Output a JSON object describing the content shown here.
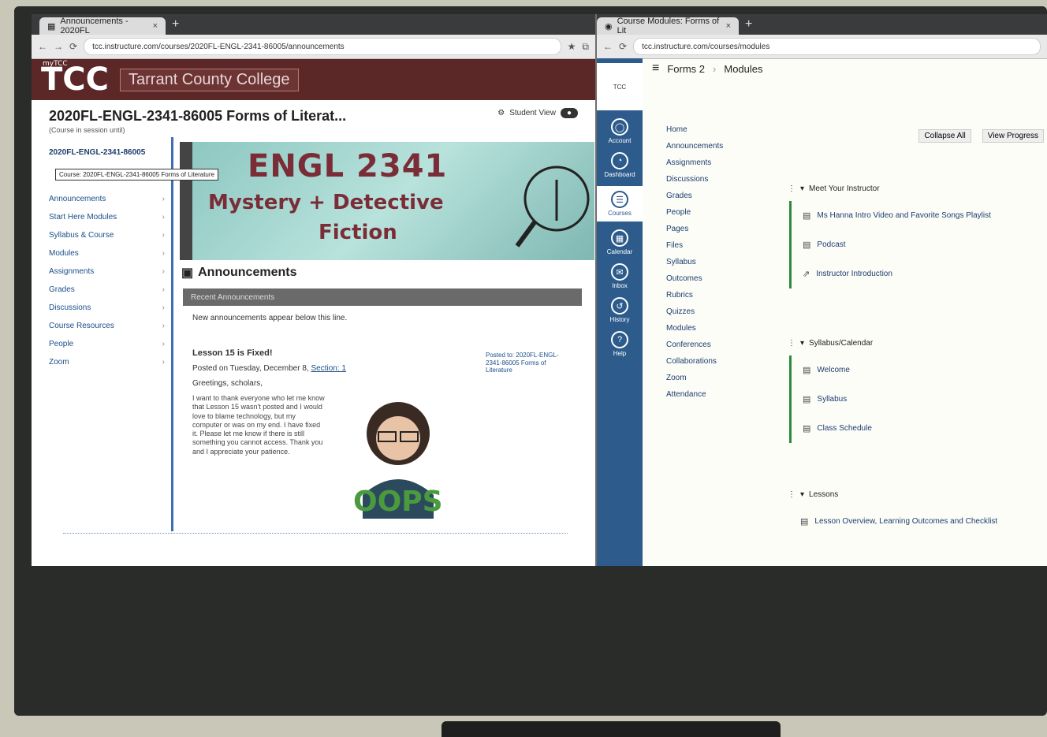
{
  "left_window": {
    "tab_title": "Announcements - 2020FL",
    "url": "tcc.instructure.com/courses/2020FL-ENGL-2341-86005/announcements",
    "tcc_logo": "TCC",
    "tcc_logo_small": "myTCC",
    "tcc_name": "Tarrant County College",
    "course_title": "2020FL-ENGL-2341-86005 Forms of Literat...",
    "course_sub": "(Course in session until)",
    "student_view": "Student View",
    "nav_crumb": "2020FL-ENGL-2341-86005",
    "tooltip": "Course: 2020FL-ENGL-2341-86005 Forms of Literature",
    "nav_items": [
      {
        "label": "Announcements"
      },
      {
        "label": "Start Here Modules"
      },
      {
        "label": "Syllabus & Course"
      },
      {
        "label": "Modules"
      },
      {
        "label": "Assignments"
      },
      {
        "label": "Grades"
      },
      {
        "label": "Discussions"
      },
      {
        "label": "Course Resources"
      },
      {
        "label": "People"
      },
      {
        "label": "Zoom"
      }
    ],
    "banner": {
      "line1": "ENGL 2341",
      "line2": "Mystery + Detective",
      "line3": "Fiction"
    },
    "announcements_heading": "Announcements",
    "ann_bar": "Recent Announcements",
    "ann_note": "New announcements appear below this line.",
    "post": {
      "title": "Lesson 15 is Fixed!",
      "meta_prefix": "Posted on Tuesday, December 8,",
      "meta_link": "Section: 1",
      "greeting": "Greetings, scholars,",
      "body": "I want to thank everyone who let me know that Lesson 15 wasn't posted and I would love to blame technology, but my computer or was on my end. I have fixed it. Please let me know if there is still something you cannot access. Thank you and I appreciate your patience."
    },
    "side_note": "Posted to: 2020FL-ENGL-2341-86005 Forms of Literature"
  },
  "right_window": {
    "tab_title": "Course Modules: Forms of Lit",
    "url": "tcc.instructure.com/courses/modules",
    "breadcrumb_course": "Forms 2",
    "breadcrumb_page": "Modules",
    "rail": [
      {
        "label": "Account",
        "icon": "account-icon"
      },
      {
        "label": "Dashboard",
        "icon": "dashboard-icon"
      },
      {
        "label": "Courses",
        "icon": "courses-icon"
      },
      {
        "label": "Calendar",
        "icon": "calendar-icon"
      },
      {
        "label": "Inbox",
        "icon": "inbox-icon"
      },
      {
        "label": "History",
        "icon": "history-icon"
      },
      {
        "label": "Help",
        "icon": "help-icon"
      }
    ],
    "nav": [
      "Home",
      "Announcements",
      "Assignments",
      "Discussions",
      "Grades",
      "People",
      "Pages",
      "Files",
      "Syllabus",
      "Outcomes",
      "Rubrics",
      "Quizzes",
      "Modules",
      "Conferences",
      "Collaborations",
      "Zoom",
      "Attendance"
    ],
    "collapse_all": "Collapse All",
    "view_progress": "View Progress",
    "modules": [
      {
        "title": "Meet Your Instructor",
        "items": [
          "Ms Hanna Intro Video and Favorite Songs Playlist",
          "Podcast",
          "Instructor Introduction"
        ]
      },
      {
        "title": "Syllabus/Calendar",
        "items": [
          "Welcome",
          "Syllabus",
          "Class Schedule"
        ]
      },
      {
        "title": "Lessons",
        "items": [
          "Lesson Overview, Learning Outcomes and Checklist"
        ]
      }
    ]
  }
}
